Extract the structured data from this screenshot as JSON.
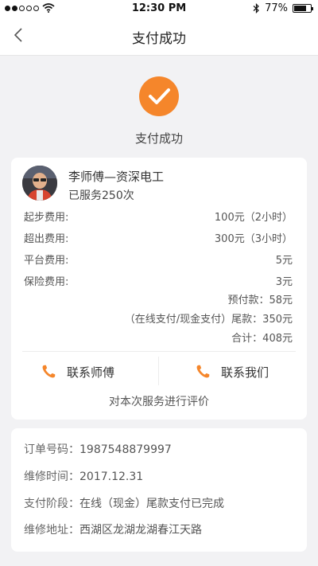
{
  "status_bar": {
    "time": "12:30 PM",
    "battery": "77%"
  },
  "nav": {
    "title": "支付成功"
  },
  "success": {
    "text": "支付成功"
  },
  "worker": {
    "name": "李师傅—资深电工",
    "served": "已服务250次"
  },
  "fees": [
    {
      "label": "起步费用:",
      "value": "100元（2小时）"
    },
    {
      "label": "超出费用:",
      "value": "300元（3小时）"
    },
    {
      "label": "平台费用:",
      "value": "5元"
    },
    {
      "label": "保险费用:",
      "value": "3元"
    }
  ],
  "totals": {
    "prepaid": "预付款：58元",
    "final": "（在线支付/现金支付）尾款：350元",
    "sum": "合计：408元"
  },
  "actions": {
    "contact_master": "联系师傅",
    "contact_us": "联系我们",
    "rate": "对本次服务进行评价"
  },
  "order": [
    {
      "label": "订单号码：",
      "value": "1987548879997"
    },
    {
      "label": "维修时间：",
      "value": "2017.12.31"
    },
    {
      "label": "支付阶段：",
      "value": "在线（现金）尾款支付已完成"
    },
    {
      "label": "维修地址：",
      "value": "西湖区龙湖龙湖春江天路"
    }
  ],
  "colors": {
    "accent": "#f5862b"
  }
}
